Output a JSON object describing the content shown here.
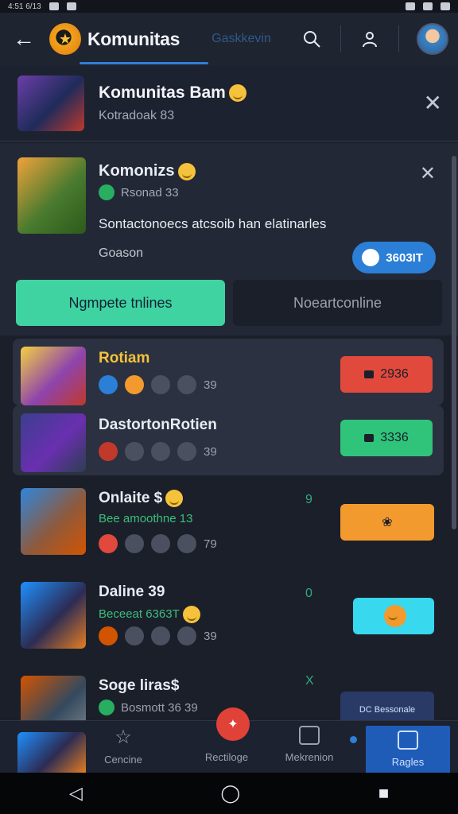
{
  "status_bar": {
    "left": "4:51 6/13"
  },
  "app_bar": {
    "title": "Komunitas",
    "subtitle": "Gaskkevin"
  },
  "banner": {
    "title": "Komunitas Bam",
    "subtitle": "Kotradoak 83"
  },
  "card": {
    "title": "Komonizs",
    "tag": "Rsonad 33",
    "description": "Sontactonoecs atcsoib han elatinarles",
    "label": "Goason",
    "follow_button": "3603IT",
    "segment_active": "Ngmpete tnlines",
    "segment_inactive": "Noeartconline"
  },
  "rows": [
    {
      "name": "Rotiam",
      "meta_count": "39",
      "pill": "2936"
    },
    {
      "name": "DastortonRotien",
      "meta_count": "39",
      "pill": "3336"
    },
    {
      "name": "Onlaite $",
      "sub": "Bee amoothne 13",
      "meta_count": "79",
      "hint": "9"
    },
    {
      "name": "Daline 39",
      "sub": "Beceeat 6363T",
      "meta_count": "39",
      "hint": "0"
    },
    {
      "name": "Soge liras$",
      "sub": "Bosmott 36 39",
      "hint": "X",
      "pill": "DC Bessonale"
    }
  ],
  "bottom_nav": {
    "items": [
      {
        "label": "Cencine"
      },
      {
        "label": "Rectiloge"
      },
      {
        "label": "Mekrenion"
      },
      {
        "label": "Ragles"
      }
    ]
  },
  "colors": {
    "accent": "#2f7fd8",
    "segment_on": "#3fd3a2",
    "pill_red": "#e0493c",
    "pill_green": "#2fc47a",
    "pill_orange": "#f39a2f",
    "pill_cyan": "#38d8ee",
    "fab": "#e04238"
  }
}
